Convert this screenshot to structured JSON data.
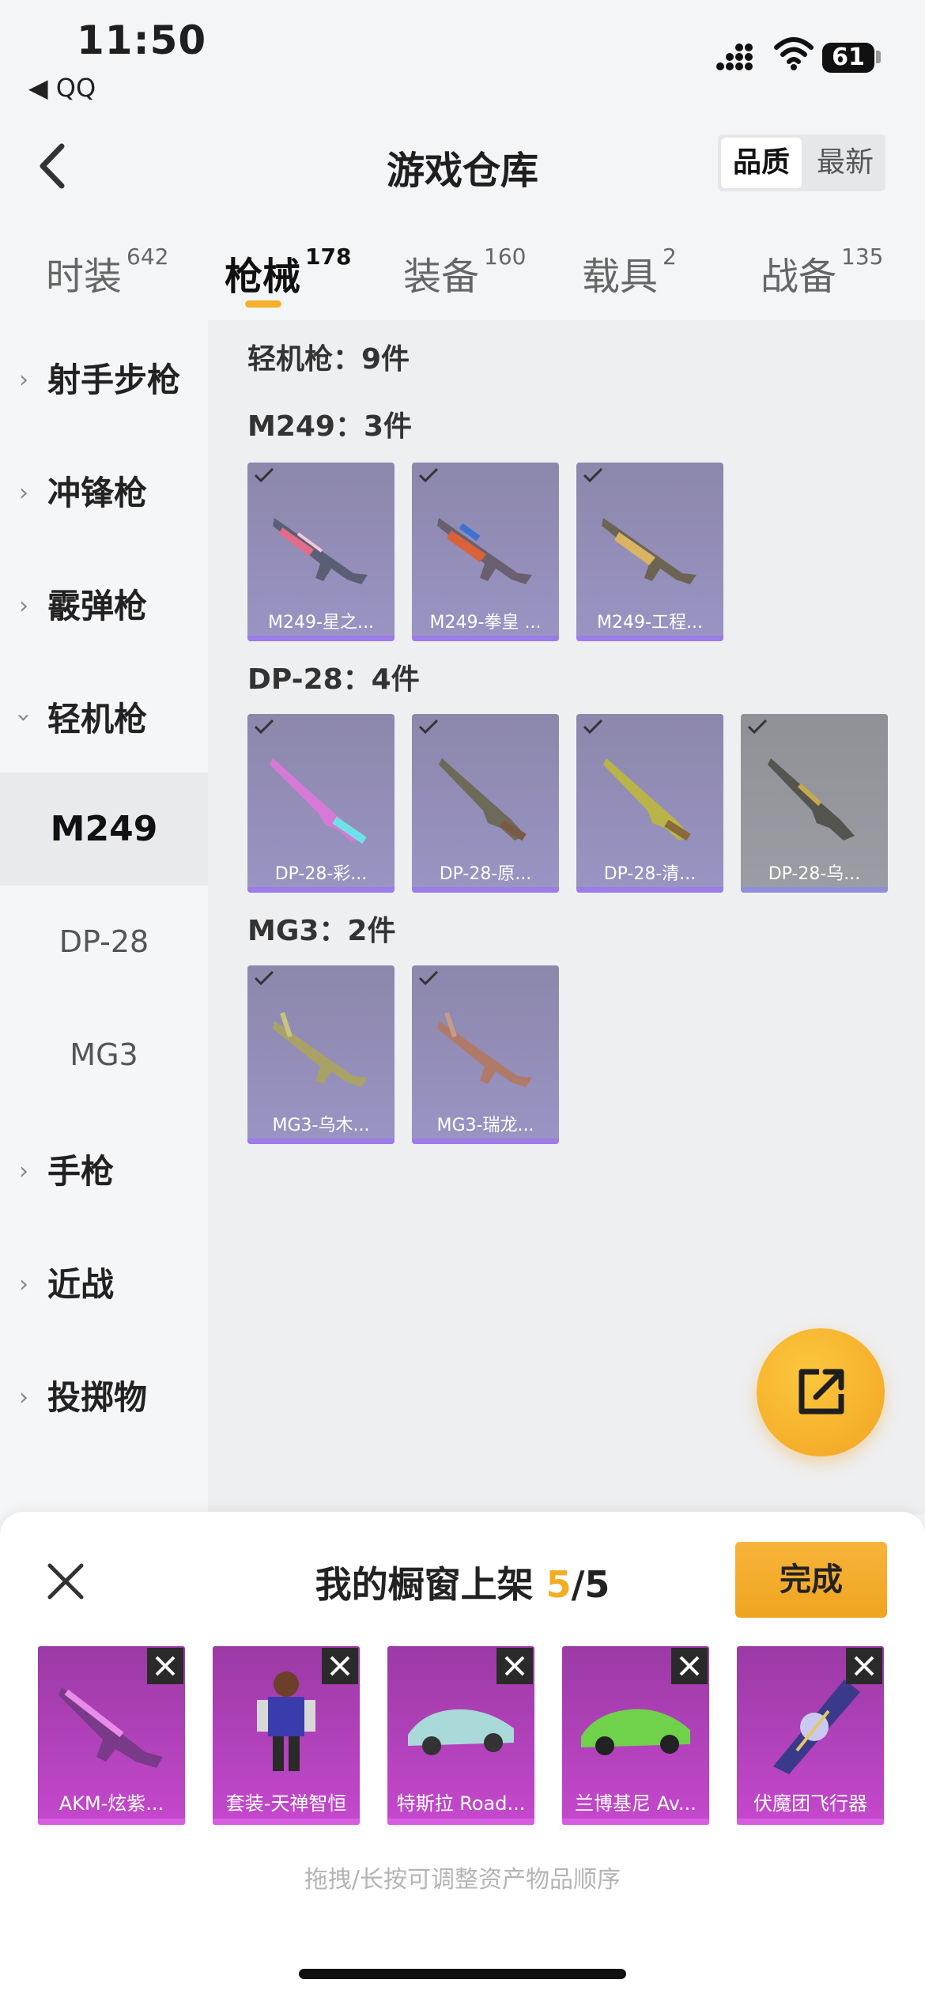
{
  "status": {
    "time": "11:50",
    "back_app": "◀ QQ",
    "battery": "61"
  },
  "header": {
    "title": "游戏仓库",
    "sort_options": [
      "品质",
      "最新"
    ]
  },
  "tabs": [
    {
      "label": "时装",
      "count": "642"
    },
    {
      "label": "枪械",
      "count": "178"
    },
    {
      "label": "装备",
      "count": "160"
    },
    {
      "label": "载具",
      "count": "2"
    },
    {
      "label": "战备",
      "count": "135"
    }
  ],
  "sidebar": {
    "categories": [
      "射手步枪",
      "冲锋枪",
      "霰弹枪",
      "轻机枪",
      "手枪",
      "近战",
      "投掷物"
    ],
    "subitems": [
      "M249",
      "DP-28",
      "MG3"
    ]
  },
  "main": {
    "category_title": "轻机枪：9件",
    "groups": [
      {
        "title": "M249：3件",
        "items": [
          "M249-星之...",
          "M249-拳皇 ...",
          "M249-工程..."
        ]
      },
      {
        "title": "DP-28：4件",
        "items": [
          "DP-28-彩...",
          "DP-28-原...",
          "DP-28-清...",
          "DP-28-乌..."
        ]
      },
      {
        "title": "MG3：2件",
        "items": [
          "MG3-乌木...",
          "MG3-瑞龙..."
        ]
      }
    ]
  },
  "sheet": {
    "title_prefix": "我的橱窗上架",
    "count_current": "5",
    "count_total": "/5",
    "done_label": "完成",
    "items": [
      "AKM-炫紫...",
      "套装-天禅智恒",
      "特斯拉 Road...",
      "兰博基尼 Av...",
      "伏魔团飞行器"
    ],
    "hint": "拖拽/长按可调整资产物品顺序"
  },
  "colors": {
    "accent": "#f2ae22",
    "card_purple": "#9a94c4",
    "shelf_magenta": "#c548cd"
  }
}
